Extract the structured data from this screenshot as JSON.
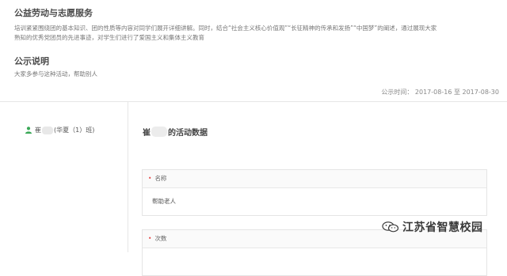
{
  "service": {
    "title": "公益劳动与志愿服务",
    "description_line1": "培训紧紧围绕团的基本知识、团的性质等内容对同学们展开详细讲解。同时，结合“社会主义核心价值观”“长征精神的传承和发扬”“中国梦”的阐述，通过展现大家",
    "description_line2": "熟知的优秀党团员的先进事迹，对学生们进行了爱国主义和集体主义教育"
  },
  "notice": {
    "title": "公示说明",
    "text": "大家多参与这种活动，帮助别人"
  },
  "publish_time": "公示时间：  2017-08-16 至 2017-08-30",
  "student": {
    "name_prefix": "崔",
    "class_info": "(华夏（1）班)"
  },
  "activity": {
    "title_prefix": "崔",
    "title_suffix": "的活动数据"
  },
  "fields": [
    {
      "label": "名称",
      "value": "帮助老人"
    },
    {
      "label": "次数",
      "value": ""
    }
  ],
  "watermark": {
    "text": "江苏省智慧校园",
    "icon": "wechat-icon"
  },
  "colors": {
    "required": "#e64a4a",
    "person_icon": "#3aa857"
  }
}
